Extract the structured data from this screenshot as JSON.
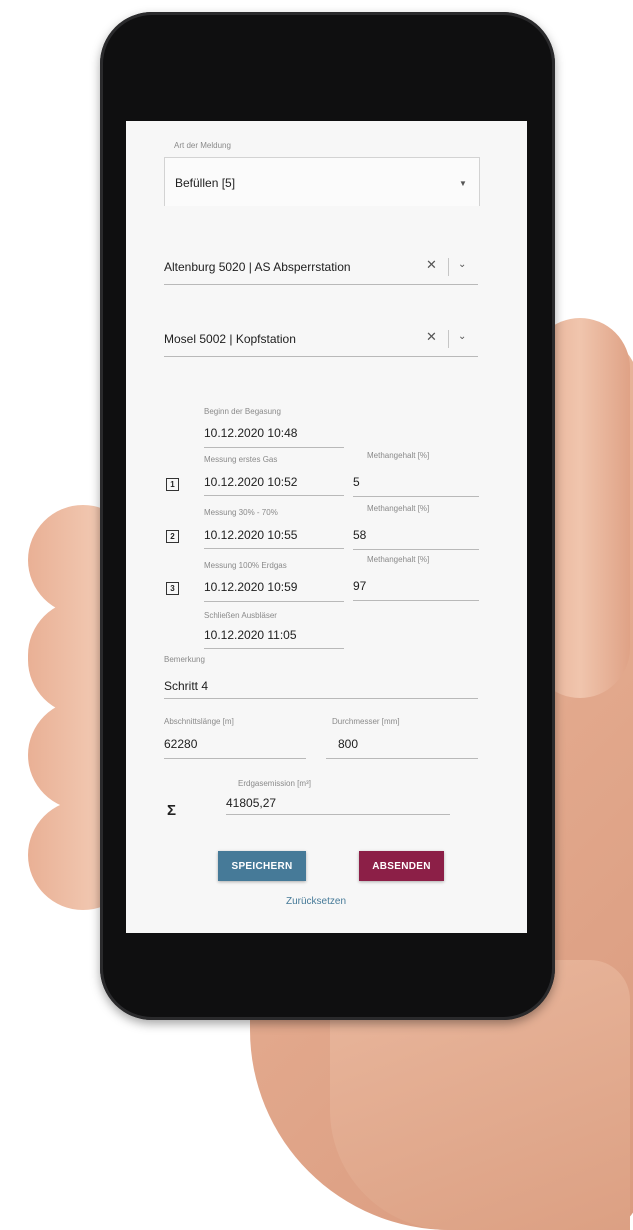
{
  "colors": {
    "primary": "#467a98",
    "accent": "#8c1f47",
    "screen_bg": "#f7f7f7",
    "text": "#202020",
    "label": "#8a8a8a"
  },
  "form": {
    "report_type": {
      "label": "Art der Meldung",
      "value": "Befüllen [5]",
      "icon": "dropdown-arrow-icon"
    },
    "station_1": {
      "value": "Altenburg 5020 | AS Absperrstation",
      "clear_icon": "close-icon",
      "dropdown_icon": "chevron-down-icon"
    },
    "station_2": {
      "value": "Mosel 5002 | Kopfstation",
      "clear_icon": "close-icon",
      "dropdown_icon": "chevron-down-icon"
    },
    "begin": {
      "label": "Beginn der Begasung",
      "value": "10.12.2020 10:48"
    },
    "steps": [
      {
        "number": "1",
        "label": "Messung erstes Gas",
        "value": "10.12.2020 10:52",
        "methane_label": "Methangehalt [%]",
        "methane_value": "5"
      },
      {
        "number": "2",
        "label": "Messung 30% - 70%",
        "value": "10.12.2020 10:55",
        "methane_label": "Methangehalt [%]",
        "methane_value": "58"
      },
      {
        "number": "3",
        "label": "Messung 100% Erdgas",
        "value": "10.12.2020 10:59",
        "methane_label": "Methangehalt [%]",
        "methane_value": "97"
      }
    ],
    "close": {
      "label": "Schließen Ausbläser",
      "value": "10.12.2020 11:05"
    },
    "remark": {
      "label": "Bemerkung",
      "value": "Schritt 4"
    },
    "section_length": {
      "label": "Abschnittslänge [m]",
      "value": "62280"
    },
    "diameter": {
      "label": "Durchmesser [mm]",
      "value": "800"
    },
    "emission": {
      "label": "Erdgasemission [m³]",
      "value": "41805,27",
      "icon": "sigma-icon"
    }
  },
  "actions": {
    "save_label": "SPEICHERN",
    "submit_label": "ABSENDEN",
    "reset_label": "Zurücksetzen"
  }
}
